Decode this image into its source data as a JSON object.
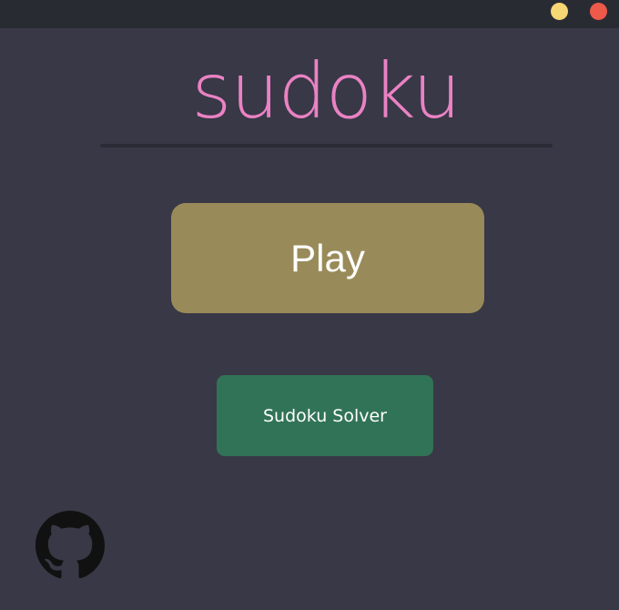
{
  "window": {
    "controls": {
      "minimize_color": "#f7d674",
      "close_color": "#ed5a4a"
    }
  },
  "main": {
    "title": "sudoku",
    "title_color": "#ea82c4",
    "play_label": "Play",
    "play_color": "#998b59",
    "solver_label": "Sudoku Solver",
    "solver_color": "#317356"
  },
  "footer": {
    "github_icon": "github-icon",
    "github_color": "#111111"
  }
}
